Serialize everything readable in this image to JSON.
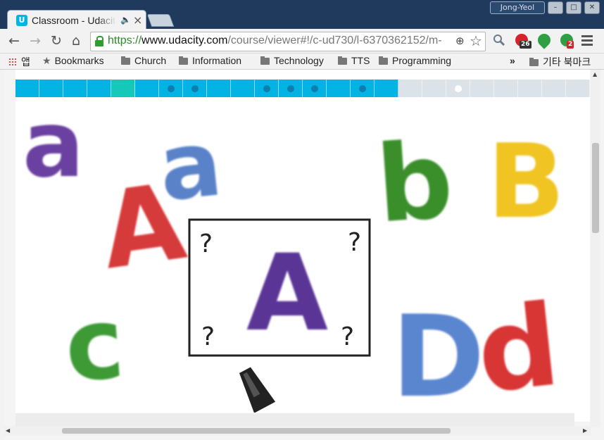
{
  "window": {
    "profile_name": "Jong-Yeol",
    "buttons": [
      "–",
      "□",
      "✕"
    ]
  },
  "tabs": [
    {
      "title": "Classroom - Udacity",
      "favicon": "U",
      "active": true,
      "audio_icon": "speaker-icon"
    },
    {
      "title": "",
      "active": false
    }
  ],
  "toolbar": {
    "back": "←",
    "forward": "→",
    "reload": "↻",
    "home": "⌂",
    "url_scheme": "https://",
    "url_host": "www.udacity.com",
    "url_path": "/course/viewer#!/c-ud730/l-6370362152/m-",
    "zoom": "⊕",
    "star": "☆",
    "extensions": [
      {
        "name": "search-extension",
        "badge": ""
      },
      {
        "name": "red-extension",
        "badge": "26",
        "color": "#d6222a"
      },
      {
        "name": "green-pin-extension",
        "badge": "",
        "color": "#2ea043"
      },
      {
        "name": "green-d-extension",
        "badge": "2",
        "color": "#2ea043"
      }
    ]
  },
  "bookmarks": {
    "apps_label": "앱",
    "items": [
      "Bookmarks",
      "Church",
      "Information",
      "Technology",
      "TTS",
      "Programming"
    ],
    "overflow": "»",
    "other_label": "기타 북마크"
  },
  "progress": {
    "total_segments": 24,
    "completed_segments": 16,
    "current_index": 4,
    "dot_indices": [
      6,
      7,
      10,
      11,
      12,
      14,
      18
    ],
    "colors": {
      "done": "#02b3e4",
      "current": "#15c8b8",
      "todo": "#dce3e8",
      "dot_done": "#0a7fb0",
      "dot_todo": "#ffffff"
    }
  },
  "video": {
    "letters": [
      {
        "char": "a",
        "color": "#6a3fa0"
      },
      {
        "char": "A",
        "color": "#d63a3a"
      },
      {
        "char": "a",
        "color": "#5a82c8"
      },
      {
        "char": "b",
        "color": "#3a8f2c"
      },
      {
        "char": "B",
        "color": "#f0c420"
      },
      {
        "char": "c",
        "color": "#3e9a35"
      },
      {
        "char": "D",
        "color": "#5a86d0"
      },
      {
        "char": "d",
        "color": "#d83434"
      }
    ],
    "center_letter": {
      "char": "A",
      "color": "#5a3596"
    },
    "question_marks": [
      "?",
      "?",
      "?",
      "?"
    ]
  }
}
